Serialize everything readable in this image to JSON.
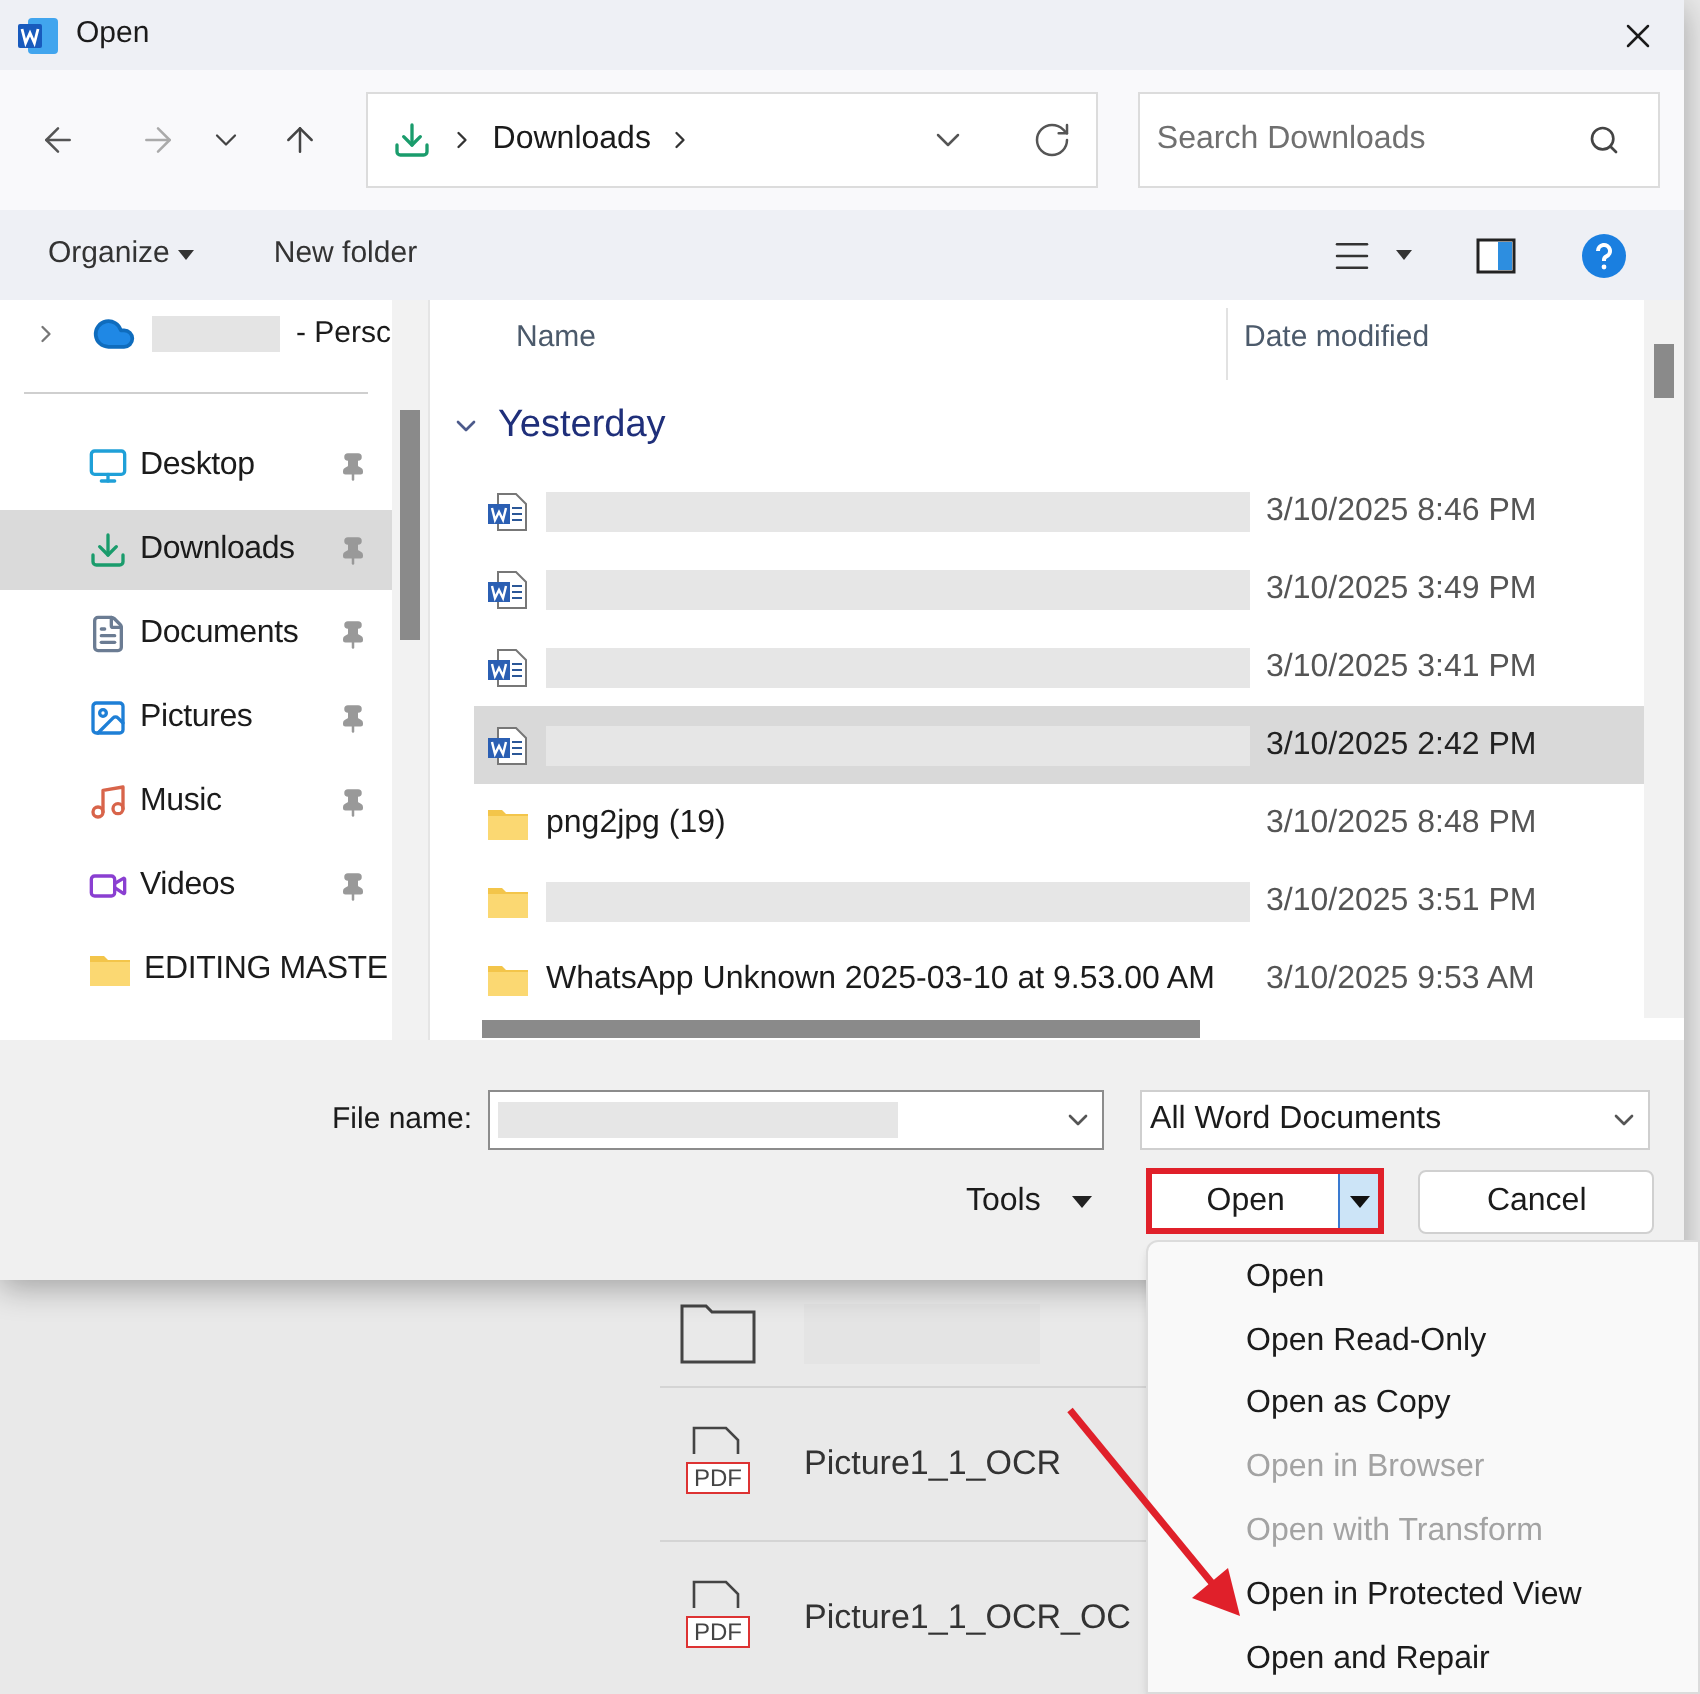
{
  "window": {
    "title": "Open"
  },
  "navigation": {
    "path": [
      "Downloads"
    ],
    "search_placeholder": "Search Downloads"
  },
  "command_bar": {
    "organize": "Organize",
    "new_folder": "New folder"
  },
  "sidebar": {
    "cloud_item": {
      "label": "- Persc",
      "expanded": false
    },
    "items": [
      {
        "kind": "desktop",
        "label": "Desktop",
        "selected": false,
        "pinned": true
      },
      {
        "kind": "downloads",
        "label": "Downloads",
        "selected": true,
        "pinned": true
      },
      {
        "kind": "documents",
        "label": "Documents",
        "selected": false,
        "pinned": true
      },
      {
        "kind": "pictures",
        "label": "Pictures",
        "selected": false,
        "pinned": true
      },
      {
        "kind": "music",
        "label": "Music",
        "selected": false,
        "pinned": true
      },
      {
        "kind": "videos",
        "label": "Videos",
        "selected": false,
        "pinned": true
      },
      {
        "kind": "folder",
        "label": "EDITING MASTE",
        "selected": false,
        "pinned": false
      }
    ]
  },
  "file_list": {
    "columns": [
      "Name",
      "Date modified"
    ],
    "group": {
      "label": "Yesterday",
      "expanded": true
    },
    "rows": [
      {
        "kind": "word",
        "date": "3/10/2025 8:46 PM",
        "selected": false
      },
      {
        "kind": "word",
        "date": "3/10/2025 3:49 PM",
        "selected": false
      },
      {
        "kind": "word",
        "date": "3/10/2025 3:41 PM",
        "selected": false
      },
      {
        "kind": "word",
        "date": "3/10/2025 2:42 PM",
        "selected": true
      },
      {
        "kind": "folder",
        "name": "png2jpg (19)",
        "date": "3/10/2025 8:48 PM",
        "selected": false
      },
      {
        "kind": "folder",
        "date": "3/10/2025 3:51 PM",
        "selected": false
      },
      {
        "kind": "folder",
        "name": "WhatsApp Unknown 2025-03-10 at 9.53.00 AM",
        "date": "3/10/2025 9:53 AM",
        "selected": false
      }
    ]
  },
  "footer": {
    "file_name_label": "File name:",
    "file_type": "All Word Documents",
    "tools": "Tools",
    "open": "Open",
    "cancel": "Cancel"
  },
  "open_menu": {
    "items": [
      {
        "label": "Open",
        "disabled": false
      },
      {
        "label": "Open Read-Only",
        "disabled": false
      },
      {
        "label": "Open as Copy",
        "disabled": false
      },
      {
        "label": "Open in Browser",
        "disabled": true
      },
      {
        "label": "Open with Transform",
        "disabled": true
      },
      {
        "label": "Open in Protected View",
        "disabled": false
      },
      {
        "label": "Open and Repair",
        "disabled": false
      }
    ]
  },
  "background_list": {
    "items": [
      {
        "kind": "folder"
      },
      {
        "kind": "pdf",
        "badge": "PDF",
        "name": "Picture1_1_OCR"
      },
      {
        "kind": "pdf",
        "badge": "PDF",
        "name": "Picture1_1_OCR_OC"
      }
    ]
  }
}
